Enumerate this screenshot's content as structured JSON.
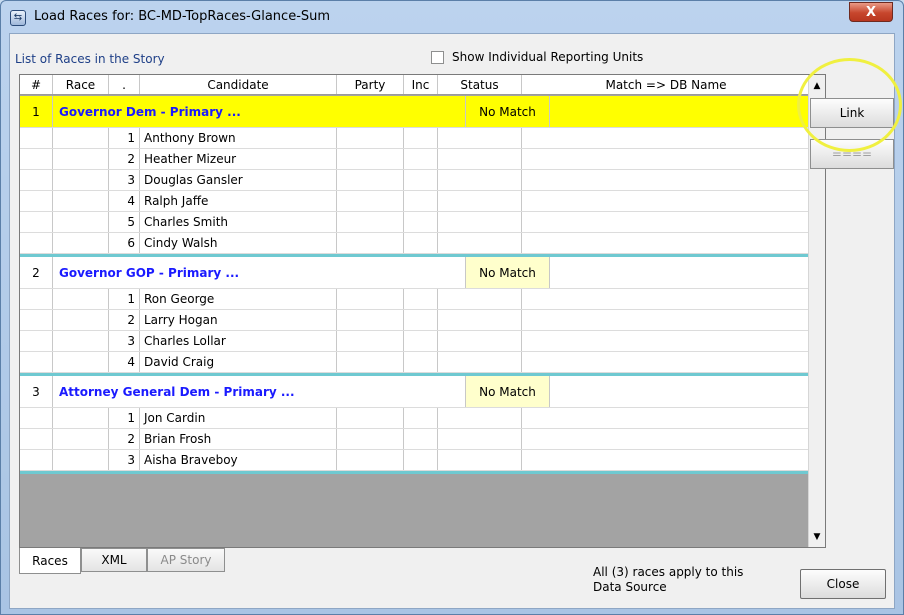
{
  "window": {
    "title": "Load Races for:  BC-MD-TopRaces-Glance-Sum",
    "app_icon": "app-icon",
    "close_glyph": "X"
  },
  "panel": {
    "caption": "List of Races in the Story",
    "show_units_label": "Show Individual Reporting Units",
    "show_units_checked": false
  },
  "columns": {
    "num": "#",
    "race": "Race",
    "dot": ".",
    "candidate": "Candidate",
    "party": "Party",
    "inc": "Inc",
    "status": "Status",
    "match": "Match => DB Name"
  },
  "races": [
    {
      "num": "1",
      "title": "Governor Dem - Primary ...",
      "status": "No Match",
      "selected": true,
      "candidates": [
        {
          "n": "1",
          "name": "Anthony Brown"
        },
        {
          "n": "2",
          "name": "Heather Mizeur"
        },
        {
          "n": "3",
          "name": "Douglas Gansler"
        },
        {
          "n": "4",
          "name": "Ralph Jaffe"
        },
        {
          "n": "5",
          "name": "Charles Smith"
        },
        {
          "n": "6",
          "name": "Cindy Walsh"
        }
      ]
    },
    {
      "num": "2",
      "title": "Governor GOP - Primary ...",
      "status": "No Match",
      "selected": false,
      "candidates": [
        {
          "n": "1",
          "name": "Ron George"
        },
        {
          "n": "2",
          "name": "Larry Hogan"
        },
        {
          "n": "3",
          "name": "Charles Lollar"
        },
        {
          "n": "4",
          "name": "David Craig"
        }
      ]
    },
    {
      "num": "3",
      "title": "Attorney General Dem - Primary ...",
      "status": "No Match",
      "selected": false,
      "candidates": [
        {
          "n": "1",
          "name": "Jon Cardin"
        },
        {
          "n": "2",
          "name": "Brian Frosh"
        },
        {
          "n": "3",
          "name": "Aisha Braveboy"
        }
      ]
    }
  ],
  "side_buttons": {
    "link": "Link",
    "unlink": "===="
  },
  "tabs": [
    {
      "label": "Races",
      "active": true,
      "disabled": false
    },
    {
      "label": "XML",
      "active": false,
      "disabled": false
    },
    {
      "label": "AP Story",
      "active": false,
      "disabled": true
    }
  ],
  "footer": {
    "note_line1": "All (3) races apply to this",
    "note_line2": "Data Source",
    "close_label": "Close"
  },
  "colors": {
    "selected_row": "#ffff00",
    "race_title": "#1a1aff",
    "separator": "#6fc9d1",
    "status_chip": "#ffffcc",
    "annotation": "#f0f040"
  }
}
